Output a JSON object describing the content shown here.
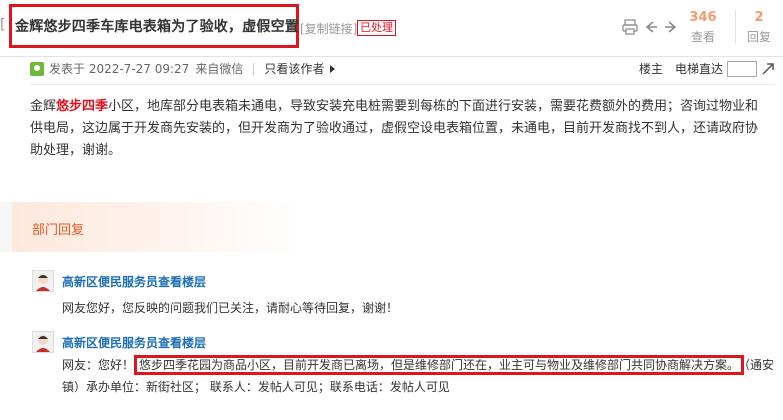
{
  "header": {
    "title_prefix": "[",
    "title": "金辉悠步四季车库电表箱为了验收，虚假空置",
    "copy_link": "[复制链接]",
    "status_tag": "已处理",
    "views_count": "346",
    "views_label": "查看",
    "replies_count": "2",
    "replies_label": "回复",
    "icons": [
      "print-icon",
      "prev-icon",
      "next-icon"
    ]
  },
  "meta": {
    "posted": "发表于 2022-7-27 09:27",
    "source": "来自微信",
    "only_author": "只看该作者",
    "floor_owner": "楼主",
    "elevator": "电梯直达"
  },
  "post": {
    "prefix": "金辉",
    "highlight": "悠步四季",
    "text": "小区，地库部分电表箱未通电，导致安装充电桩需要到每栋的下面进行安装，需要花费额外的费用；咨询过物业和供电局，这边属于开发商先安装的，但开发商为了验收通过，虚假空设电表箱位置，未通电，目前开发商找不到人，还请政府协助处理，谢谢。"
  },
  "department": {
    "label": "部门回复"
  },
  "replies": [
    {
      "name": "高新区便民服务员查看楼层",
      "text": "网友您好，您反映的问题我们已关注，请耐心等待回复，谢谢！"
    },
    {
      "name": "高新区便民服务员查看楼层",
      "prefix": "网友：您好！",
      "highlight_text": "悠步四季花园为商品小区，目前开发商已离场，但是维修部门还在，业主可与物业及维修部门共同协商解决方案。",
      "suffix": "（通安",
      "line2": "镇）承办单位：新街社区；  联系人：发帖人可见；联系电话：发帖人可见"
    }
  ],
  "colors": {
    "accent_red": "#e0141e",
    "stat_orange": "#f29a6b",
    "link_blue": "#1f6fb5",
    "dept_orange": "#e35d2a"
  }
}
